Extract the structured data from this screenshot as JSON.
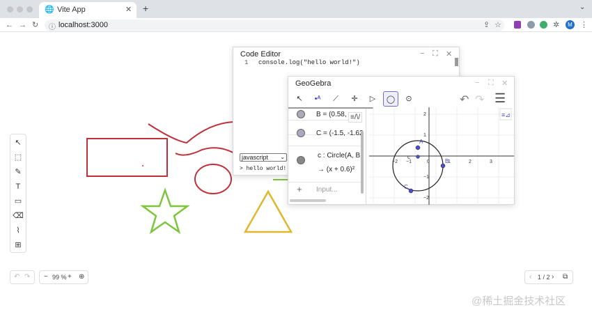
{
  "browser": {
    "tab_title": "Vite App",
    "url": "localhost:3000",
    "profile_initial": "M"
  },
  "icons": {
    "tab": "globe-icon",
    "close": "close-icon",
    "new_tab": "plus-icon",
    "back": "arrow-left-icon",
    "forward": "arrow-right-icon",
    "reload": "reload-icon",
    "site_info": "info-icon",
    "share": "share-icon",
    "bookmark": "star-icon",
    "extensions": "puzzle-icon"
  },
  "left_tools": [
    {
      "name": "select-tool",
      "glyph": "↖"
    },
    {
      "name": "frame-tool",
      "glyph": "⬚"
    },
    {
      "name": "pen-tool",
      "glyph": "✎"
    },
    {
      "name": "text-tool",
      "glyph": "T"
    },
    {
      "name": "rectangle-tool",
      "glyph": "▭"
    },
    {
      "name": "eraser-tool",
      "glyph": "⌫"
    },
    {
      "name": "brush-tool",
      "glyph": "⌇"
    },
    {
      "name": "apps-tool",
      "glyph": "⊞"
    }
  ],
  "code_editor": {
    "title": "Code Editor",
    "line_number": "1",
    "code": "console.log(\"hello world!\")",
    "language": "javascript",
    "output": "> hello world!"
  },
  "geogebra": {
    "title": "GeoGebra",
    "algebra": [
      {
        "text": "B = (0.58,"
      },
      {
        "text": "C = (-1.5, -1.62"
      },
      {
        "text": "c : Circle(A, B",
        "sub": "→ (x + 0.6)²"
      }
    ],
    "input_placeholder": "Input...",
    "x_ticks": [
      "−2",
      "−1",
      "0",
      "1",
      "2",
      "3"
    ],
    "y_ticks": [
      "2",
      "1",
      "−1",
      "−2"
    ],
    "points": [
      {
        "label": "A"
      },
      {
        "label": "B"
      },
      {
        "label": "C"
      }
    ],
    "center_label": "c"
  },
  "bottom_bar": {
    "zoom": "99 %",
    "page": "1 / 2"
  },
  "colors": {
    "rect_stroke": "#c0303a",
    "star_stroke": "#7cc63c",
    "triangle_stroke": "#e0b62a",
    "point_fill": "#4d4dcc"
  },
  "watermark": "@稀土掘金技术社区"
}
